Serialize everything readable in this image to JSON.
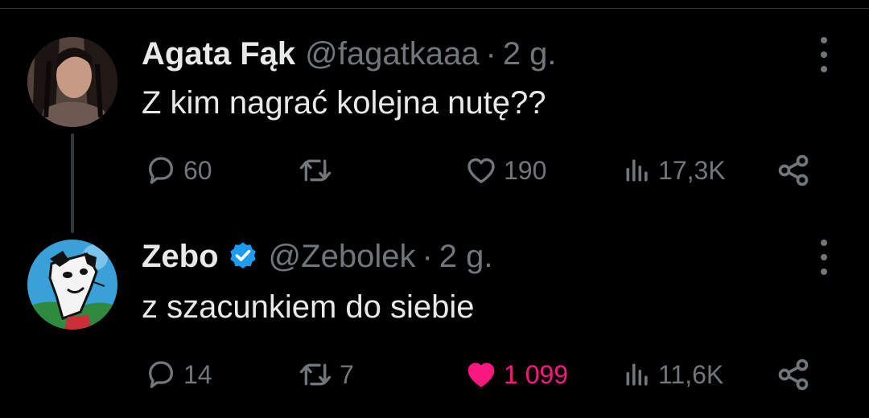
{
  "tweets": [
    {
      "name": "Agata Fąk",
      "handle": "@fagatkaaa",
      "dot": "·",
      "time": "2 g.",
      "text": "Z kim nagrać kolejna nutę??",
      "replies": "60",
      "retweets": "",
      "likes": "190",
      "views": "17,3K",
      "liked": false,
      "verified": false
    },
    {
      "name": "Zebo",
      "handle": "@Zebolek",
      "dot": "·",
      "time": "2 g.",
      "text": "z szacunkiem do siebie",
      "replies": "14",
      "retweets": "7",
      "likes": "1 099",
      "views": "11,6K",
      "liked": true,
      "verified": true
    }
  ],
  "colors": {
    "background": "#000000",
    "text": "#e7e9ea",
    "muted": "#71767b",
    "like_active": "#f91880",
    "verified": "#1d9bf0"
  },
  "icons": [
    "reply-icon",
    "retweet-icon",
    "like-icon",
    "views-icon",
    "share-icon",
    "more-icon",
    "verified-badge-icon"
  ]
}
